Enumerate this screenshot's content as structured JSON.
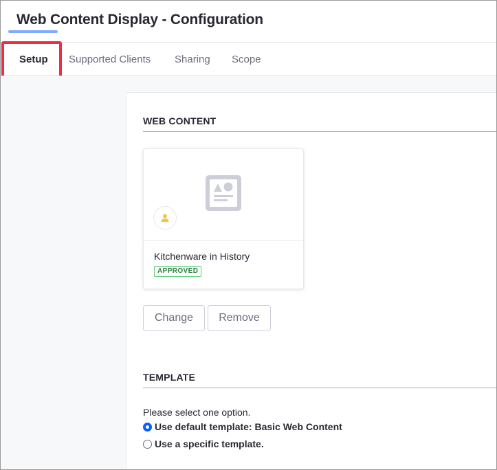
{
  "window": {
    "title": "Web Content Display - Configuration"
  },
  "tabs": [
    {
      "label": "Setup",
      "active": true
    },
    {
      "label": "Supported Clients",
      "active": false
    },
    {
      "label": "Sharing",
      "active": false
    },
    {
      "label": "Scope",
      "active": false
    }
  ],
  "web_content": {
    "section_title": "WEB CONTENT",
    "card": {
      "title": "Kitchenware in History",
      "status": "APPROVED",
      "image_icon": "web-content-icon",
      "avatar_icon": "user-icon"
    },
    "change_label": "Change",
    "remove_label": "Remove"
  },
  "template": {
    "section_title": "TEMPLATE",
    "hint": "Please select one option.",
    "options": [
      {
        "label": "Use default template: Basic Web Content",
        "checked": true
      },
      {
        "label": "Use a specific template.",
        "checked": false
      }
    ]
  },
  "colors": {
    "highlight": "#ee2d43",
    "tab_underline": "#80acff",
    "approved": "#287d3c",
    "radio_checked": "#0b5fff"
  }
}
